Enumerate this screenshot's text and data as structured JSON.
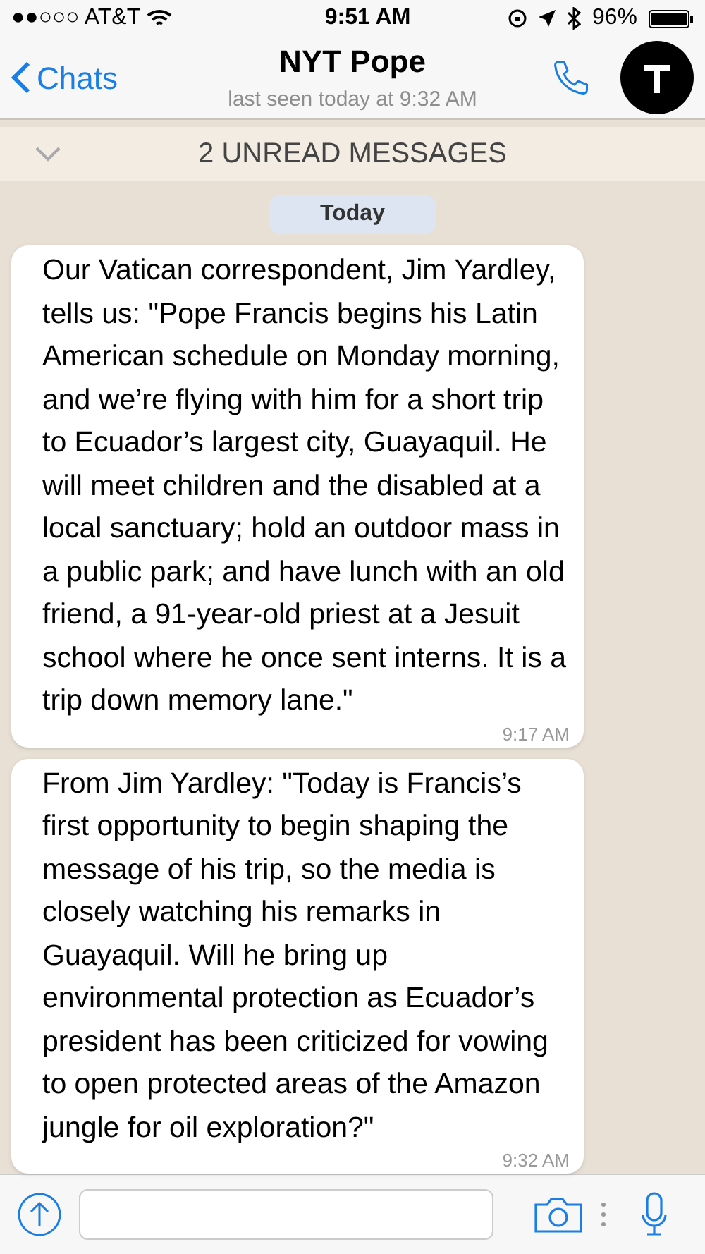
{
  "status_bar": {
    "carrier": "●●○○○ AT&T",
    "time": "9:51 AM",
    "battery": "96%"
  },
  "header": {
    "back": "Chats",
    "title": "NYT Pope",
    "subtitle": "last seen today at 9:32 AM"
  },
  "unread_banner": "2 UNREAD MESSAGES",
  "date_pill": "Today",
  "messages": [
    {
      "text": "Our Vatican correspondent, Jim Yardley, tells us: \"Pope Francis begins his Latin American schedule on Monday morning, and we’re flying with him for a short trip to Ecuador’s largest city, Guayaquil. He will meet children and the disabled at a local sanctuary; hold an outdoor mass in a public park; and have lunch with an old friend, a 91-year-old priest at a Jesuit school where he once sent interns. It is a trip down memory lane.\"",
      "time": "9:17 AM"
    },
    {
      "text": "From Jim Yardley: \"Today is Francis’s first opportunity to begin shaping the message of his trip, so the media is closely watching his remarks in Guayaquil. Will he bring up environmental protection as Ecuador’s president has been criticized for vowing to open protected areas of the Amazon jungle for oil exploration?\"",
      "time": "9:32 AM"
    }
  ]
}
